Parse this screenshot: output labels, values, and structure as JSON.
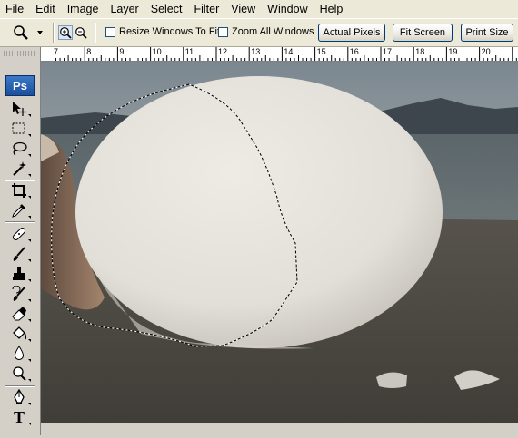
{
  "menu": [
    "File",
    "Edit",
    "Image",
    "Layer",
    "Select",
    "Filter",
    "View",
    "Window",
    "Help"
  ],
  "options": {
    "zoom_tool_icon": "magnifier-icon",
    "resize_windows_to_fit": {
      "label": "Resize Windows To Fit",
      "checked": false
    },
    "zoom_all_windows": {
      "label": "Zoom All Windows",
      "checked": false
    },
    "buttons": [
      "Actual Pixels",
      "Fit Screen",
      "Print Size"
    ]
  },
  "toolbox": {
    "logo": "Ps",
    "tools": [
      {
        "icon": "move-tool-icon"
      },
      {
        "icon": "rectangular-marquee-icon"
      },
      {
        "icon": "lasso-icon"
      },
      {
        "icon": "magic-wand-icon"
      },
      {
        "icon": "crop-icon"
      },
      {
        "icon": "eyedropper-icon"
      },
      {
        "icon": "healing-brush-icon"
      },
      {
        "icon": "brush-icon"
      },
      {
        "icon": "clone-stamp-icon"
      },
      {
        "icon": "history-brush-icon"
      },
      {
        "icon": "eraser-icon"
      },
      {
        "icon": "paint-bucket-icon"
      },
      {
        "icon": "blur-icon"
      },
      {
        "icon": "dodge-icon"
      },
      {
        "icon": "pen-icon"
      },
      {
        "icon": "type-icon",
        "glyph": "T"
      }
    ]
  },
  "ruler": {
    "labels": [
      "7",
      "8",
      "9",
      "10",
      "11",
      "12",
      "13",
      "14",
      "15",
      "16",
      "17",
      "18",
      "19",
      "20"
    ]
  },
  "colors": {
    "chrome": "#ece9d8",
    "panel": "#d4d0c8",
    "egg": "#e8e5de",
    "sky": "#7f8a91",
    "sea": "#5a6468",
    "sand": "#47443e"
  }
}
